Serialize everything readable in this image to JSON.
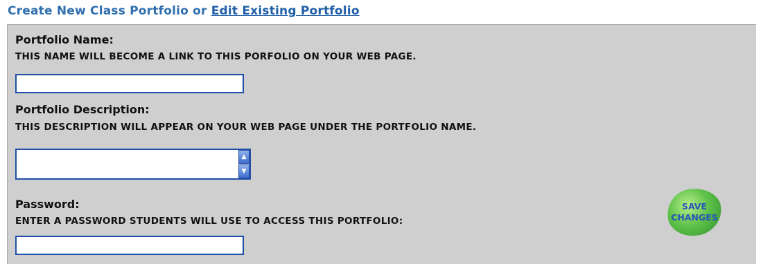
{
  "header": {
    "create_text": "Create New Class Portfolio or ",
    "edit_link": "Edit Existing Portfolio"
  },
  "portfolio_name": {
    "label": "Portfolio Name:",
    "hint": "THIS NAME WILL BECOME A LINK TO THIS PORFOLIO ON YOUR WEB PAGE.",
    "value": ""
  },
  "portfolio_description": {
    "label": "Portfolio Description:",
    "hint": "THIS DESCRIPTION WILL APPEAR ON YOUR WEB PAGE UNDER THE PORTFOLIO NAME.",
    "value": ""
  },
  "password": {
    "label": "Password:",
    "hint": "ENTER A PASSWORD STUDENTS WILL USE TO ACCESS THIS PORTFOLIO:",
    "value": ""
  },
  "save_button": {
    "line1": "SAVE",
    "line2": "CHANGES"
  },
  "colors": {
    "panel": "#cfcfcf",
    "header": "#2f6fae",
    "field_border": "#1f4fa8",
    "save_green": "#5fc24a"
  },
  "icons": {
    "scroll_up": "scroll-up-arrow-icon",
    "scroll_down": "scroll-down-arrow-icon"
  }
}
